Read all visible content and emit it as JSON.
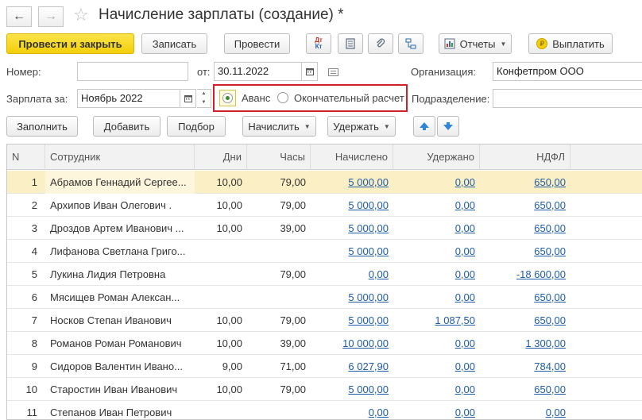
{
  "window": {
    "title": "Начисление зарплаты (создание) *"
  },
  "toolbar": {
    "post_close": "Провести и закрыть",
    "save": "Записать",
    "post": "Провести",
    "dtkt_top": "Дт",
    "dtkt_bottom": "Кт",
    "reports": "Отчеты",
    "pay": "Выплатить"
  },
  "form": {
    "number_label": "Номер:",
    "number_value": "",
    "from_label": "от:",
    "date_value": "30.11.2022",
    "org_label": "Организация:",
    "org_value": "Конфетпром ООО",
    "salary_for_label": "Зарплата за:",
    "month_value": "Ноябрь 2022",
    "radio_advance": "Аванс",
    "radio_final": "Окончательный расчет",
    "division_label": "Подразделение:",
    "division_value": ""
  },
  "actions": {
    "fill": "Заполнить",
    "add": "Добавить",
    "pick": "Подбор",
    "accrue": "Начислить",
    "withhold": "Удержать"
  },
  "colors": {
    "accent_yellow": "#f2cf0b",
    "highlight_red": "#d0202a",
    "selected_row": "#fbefc6",
    "link": "#1f5ca8"
  },
  "table": {
    "headers": [
      "N",
      "Сотрудник",
      "Дни",
      "Часы",
      "Начислено",
      "Удержано",
      "НДФЛ"
    ],
    "rows": [
      [
        "1",
        "Абрамов Геннадий Сергее...",
        "10,00",
        "79,00",
        "5 000,00",
        "0,00",
        "650,00"
      ],
      [
        "2",
        "Архипов Иван Олегович .",
        "10,00",
        "79,00",
        "5 000,00",
        "0,00",
        "650,00"
      ],
      [
        "3",
        "Дроздов Артем Иванович ...",
        "10,00",
        "39,00",
        "5 000,00",
        "0,00",
        "650,00"
      ],
      [
        "4",
        "Лифанова Светлана Григо...",
        "",
        "",
        "5 000,00",
        "0,00",
        "650,00"
      ],
      [
        "5",
        "Лукина Лидия Петровна",
        "",
        "79,00",
        "0,00",
        "0,00",
        "-18 600,00"
      ],
      [
        "6",
        "Мясищев Роман Алексан...",
        "",
        "",
        "5 000,00",
        "0,00",
        "650,00"
      ],
      [
        "7",
        "Носков Степан Иванович",
        "10,00",
        "79,00",
        "5 000,00",
        "1 087,50",
        "650,00"
      ],
      [
        "8",
        "Романов Роман Романович",
        "10,00",
        "39,00",
        "10 000,00",
        "0,00",
        "1 300,00"
      ],
      [
        "9",
        "Сидоров Валентин Ивано...",
        "9,00",
        "71,00",
        "6 027,90",
        "0,00",
        "784,00"
      ],
      [
        "10",
        "Старостин Иван Иванович",
        "10,00",
        "79,00",
        "5 000,00",
        "0,00",
        "650,00"
      ],
      [
        "11",
        "Степанов Иван Петрович",
        "",
        "",
        "0,00",
        "0,00",
        "0,00"
      ]
    ]
  }
}
